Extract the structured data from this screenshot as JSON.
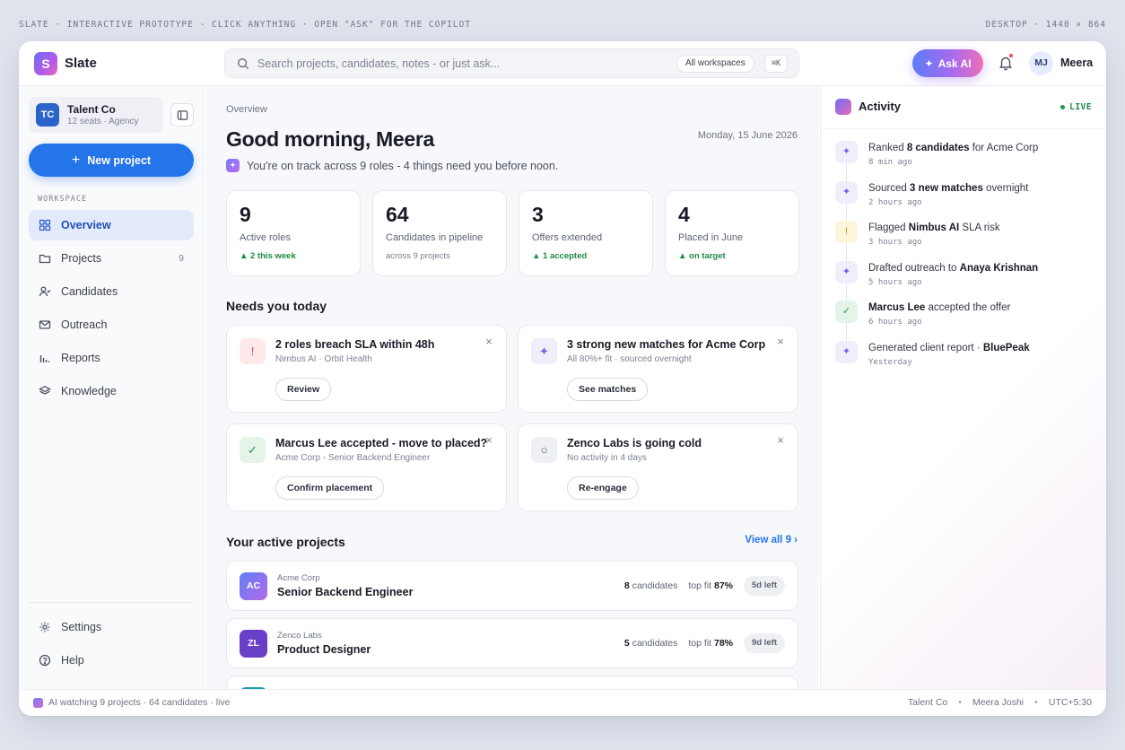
{
  "topbar": {
    "left": "SLATE · INTERACTIVE PROTOTYPE - CLICK ANYTHING · OPEN \"ASK\" FOR THE COPILOT",
    "right": "DESKTOP · 1440 × 864"
  },
  "header": {
    "logo_letter": "S",
    "brand": "Slate",
    "search_placeholder": "Search projects, candidates, notes - or just ask...",
    "workspace_pill": "All workspaces",
    "shortcut": "⌘K",
    "ask_ai": "Ask AI",
    "user_initials": "MJ",
    "user_name": "Meera"
  },
  "sidebar": {
    "org": {
      "initials": "TC",
      "name": "Talent Co",
      "sub": "12 seats · Agency"
    },
    "new_project": "New project",
    "section_label": "WORKSPACE",
    "items": [
      {
        "label": "Overview",
        "icon": "grid-icon",
        "active": true
      },
      {
        "label": "Projects",
        "icon": "folder-icon",
        "count": "9"
      },
      {
        "label": "Candidates",
        "icon": "user-check-icon"
      },
      {
        "label": "Outreach",
        "icon": "mail-icon"
      },
      {
        "label": "Reports",
        "icon": "bar-chart-icon"
      },
      {
        "label": "Knowledge",
        "icon": "layers-icon"
      }
    ],
    "bottom": [
      {
        "label": "Settings",
        "icon": "gear-icon"
      },
      {
        "label": "Help",
        "icon": "help-circle-icon"
      }
    ]
  },
  "main": {
    "breadcrumb": "Overview",
    "greeting": "Good morning, Meera",
    "date": "Monday, 15 June 2026",
    "summary": "You're on track across 9 roles - 4 things need you before noon.",
    "stats": [
      {
        "value": "9",
        "label": "Active roles",
        "sub": "▲ 2 this week",
        "good": true
      },
      {
        "value": "64",
        "label": "Candidates in pipeline",
        "sub": "across 9 projects",
        "good": false
      },
      {
        "value": "3",
        "label": "Offers extended",
        "sub": "▲ 1 accepted",
        "good": true
      },
      {
        "value": "4",
        "label": "Placed in June",
        "sub": "▲ on target",
        "good": true
      }
    ],
    "needs_title": "Needs you today",
    "cards": [
      {
        "title": "2 roles breach SLA within 48h",
        "sub": "Nimbus AI · Orbit Health",
        "button": "Review",
        "icon": "!",
        "tone": "danger"
      },
      {
        "title": "3 strong new matches for Acme Corp",
        "sub": "All 80%+ fit · sourced overnight",
        "button": "See matches",
        "icon": "✦",
        "tone": "ai"
      },
      {
        "title": "Marcus Lee accepted - move to placed?",
        "sub": "Acme Corp - Senior Backend Engineer",
        "button": "Confirm placement",
        "icon": "✓",
        "tone": "ok"
      },
      {
        "title": "Zenco Labs is going cold",
        "sub": "No activity in 4 days",
        "button": "Re-engage",
        "icon": "○",
        "tone": "neutral"
      }
    ],
    "projects_title": "Your active projects",
    "view_all": "View all 9 ›",
    "projects": [
      {
        "initials": "AC",
        "client": "Acme Corp",
        "role": "Senior Backend Engineer",
        "candidates": "8",
        "candidates_label": "candidates",
        "fit_label": "top fit",
        "fit": "87%",
        "left": "5d left",
        "color": "#7a6ff0"
      },
      {
        "initials": "ZL",
        "client": "Zenco Labs",
        "role": "Product Designer",
        "candidates": "5",
        "candidates_label": "candidates",
        "fit_label": "top fit",
        "fit": "78%",
        "left": "9d left",
        "color": "#6a3fc8"
      }
    ]
  },
  "activity": {
    "title": "Activity",
    "live": "LIVE",
    "items": [
      {
        "pre": "Ranked ",
        "bold": "8 candidates",
        "post": " for Acme Corp",
        "time": "8 min ago",
        "tone": "ai",
        "icon": "✦"
      },
      {
        "pre": "Sourced ",
        "bold": "3 new matches",
        "post": " overnight",
        "time": "2 hours ago",
        "tone": "ai",
        "icon": "✦"
      },
      {
        "pre": "Flagged ",
        "bold": "Nimbus AI",
        "post": " SLA risk",
        "time": "3 hours ago",
        "tone": "warn",
        "icon": "!"
      },
      {
        "pre": "Drafted outreach to ",
        "bold": "Anaya Krishnan",
        "post": "",
        "time": "5 hours ago",
        "tone": "ai",
        "icon": "✦"
      },
      {
        "pre": "",
        "bold": "Marcus Lee",
        "post": " accepted the offer",
        "time": "6 hours ago",
        "tone": "ok",
        "icon": "✓"
      },
      {
        "pre": "Generated client report · ",
        "bold": "BluePeak",
        "post": "",
        "time": "Yesterday",
        "tone": "ai",
        "icon": "✦"
      }
    ]
  },
  "footer": {
    "status": "AI watching 9 projects · 64 candidates · live",
    "org": "Talent Co",
    "user": "Meera Joshi",
    "tz": "UTC+5:30",
    "sep": "•"
  }
}
